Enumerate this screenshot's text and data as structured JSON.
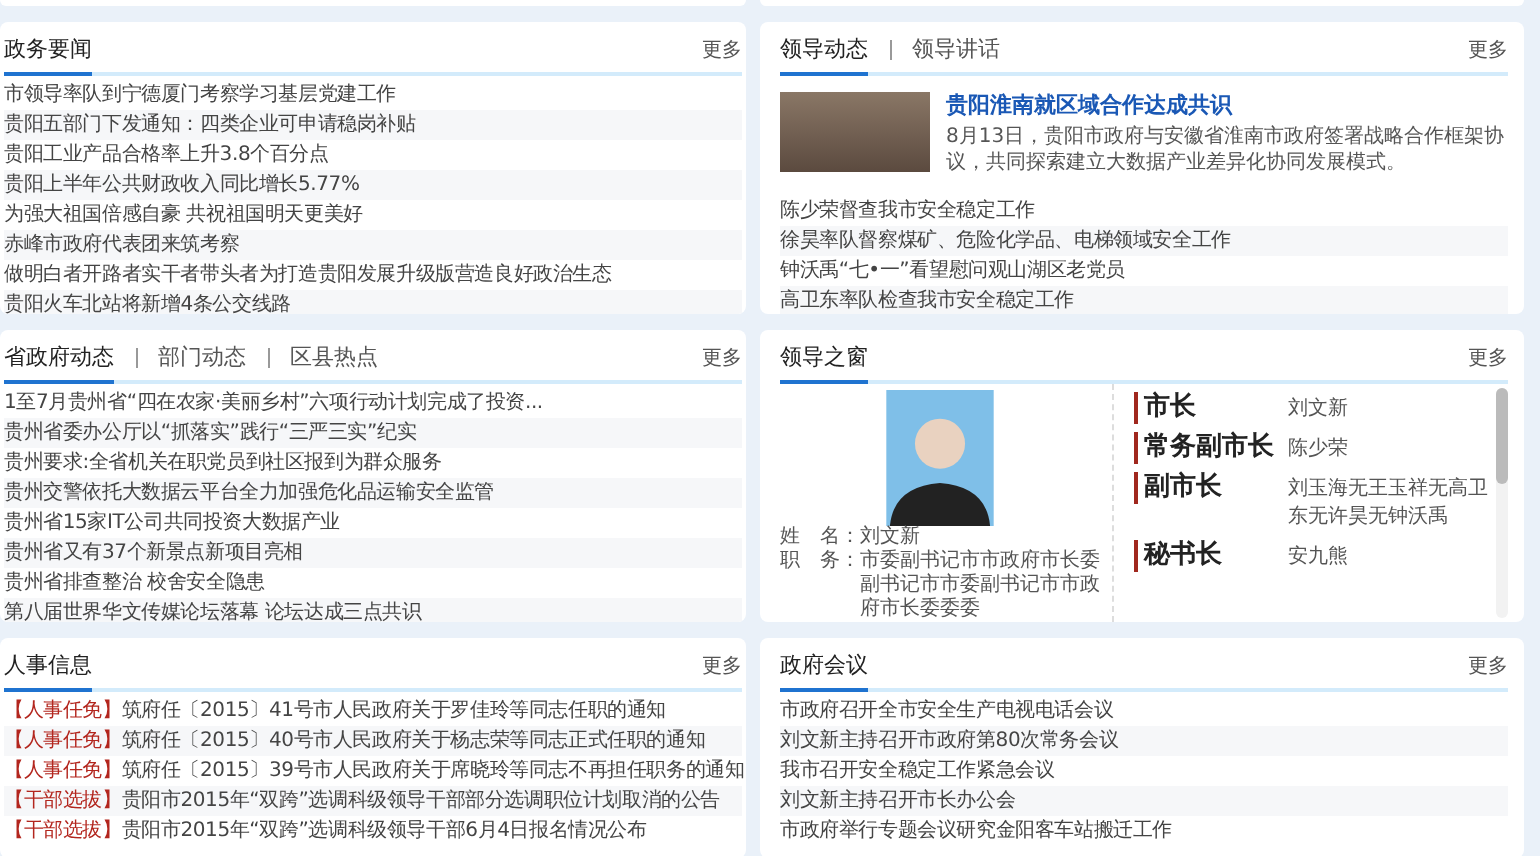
{
  "panels": [
    {
      "kind": "news",
      "tabs": [
        {
          "label": "政务要闻",
          "selected": true
        }
      ],
      "more": "更多",
      "items": [
        "市领导率队到宁德厦门考察学习基层党建工作",
        "贵阳五部门下发通知：四类企业可申请稳岗补贴",
        "贵阳工业产品合格率上升3.8个百分点",
        "贵阳上半年公共财政收入同比增长5.77%",
        "为强大祖国倍感自豪 共祝祖国明天更美好",
        "赤峰市政府代表团来筑考察",
        "做明白者开路者实干者带头者为打造贵阳发展升级版营造良好政治生态",
        "贵阳火车北站将新增4条公交线路"
      ]
    },
    {
      "kind": "feature",
      "tabs": [
        {
          "label": "领导动态",
          "selected": true
        },
        {
          "label": "领导讲话",
          "selected": false
        }
      ],
      "more": "更多",
      "feature": {
        "title": "贵阳淮南就区域合作达成共识",
        "summary": "8月13日，贵阳市政府与安徽省淮南市政府签署战略合作框架协议，共同探索建立大数据产业差异化协同发展模式。"
      },
      "items": [
        "陈少荣督查我市安全稳定工作",
        "徐昊率队督察煤矿、危险化学品、电梯领域安全工作",
        "钟沃禹“七•一”看望慰问观山湖区老党员",
        "高卫东率队检查我市安全稳定工作"
      ]
    },
    {
      "kind": "news",
      "tabs": [
        {
          "label": "省政府动态",
          "selected": true
        },
        {
          "label": "部门动态",
          "selected": false
        },
        {
          "label": "区县热点",
          "selected": false
        }
      ],
      "more": "更多",
      "items": [
        "1至7月贵州省“四在农家·美丽乡村”六项行动计划完成了投资...",
        "贵州省委办公厅以“抓落实”践行“三严三实”纪实",
        "贵州要求:全省机关在职党员到社区报到为群众服务",
        "贵州交警依托大数据云平台全力加强危化品运输安全监管",
        "贵州省15家IT公司共同投资大数据产业",
        "贵州省又有37个新景点新项目亮相",
        "贵州省排查整治 校舍安全隐患",
        "第八届世界华文传媒论坛落幕 论坛达成三点共识"
      ]
    },
    {
      "kind": "leaders",
      "tabs": [
        {
          "label": "领导之窗",
          "selected": true
        }
      ],
      "more": "更多",
      "profile": {
        "name_label": "姓　名：",
        "name": "刘文新",
        "post_label": "职　务：",
        "post": "市委副书记市市政府市长委副书记市市委副书记市市政府市长委委委"
      },
      "roles": [
        {
          "title": "市长",
          "names": "刘文新"
        },
        {
          "title": "常务副市长",
          "names": "陈少荣"
        },
        {
          "title": "副市长",
          "names": "刘玉海无王玉祥无高卫东无许昊无钟沃禹"
        },
        {
          "title": "秘书长",
          "names": "安九熊"
        }
      ]
    },
    {
      "kind": "tagged",
      "tabs": [
        {
          "label": "人事信息",
          "selected": true
        }
      ],
      "more": "更多",
      "items": [
        {
          "tag": "【人事任免】",
          "text": "筑府任〔2015〕41号市人民政府关于罗佳玲等同志任职的通知"
        },
        {
          "tag": "【人事任免】",
          "text": "筑府任〔2015〕40号市人民政府关于杨志荣等同志正式任职的通知"
        },
        {
          "tag": "【人事任免】",
          "text": "筑府任〔2015〕39号市人民政府关于席晓玲等同志不再担任职务的通知"
        },
        {
          "tag": "【干部选拔】",
          "text": "贵阳市2015年“双跨”选调科级领导干部部分选调职位计划取消的公告"
        },
        {
          "tag": "【干部选拔】",
          "text": "贵阳市2015年“双跨”选调科级领导干部6月4日报名情况公布"
        }
      ]
    },
    {
      "kind": "news",
      "tabs": [
        {
          "label": "政府会议",
          "selected": true
        }
      ],
      "more": "更多",
      "items": [
        "市政府召开全市安全生产电视电话会议",
        "刘文新主持召开市政府第80次常务会议",
        "我市召开安全稳定工作紧急会议",
        "刘文新主持召开市长办公会",
        "市政府举行专题会议研究金阳客车站搬迁工作"
      ]
    }
  ]
}
